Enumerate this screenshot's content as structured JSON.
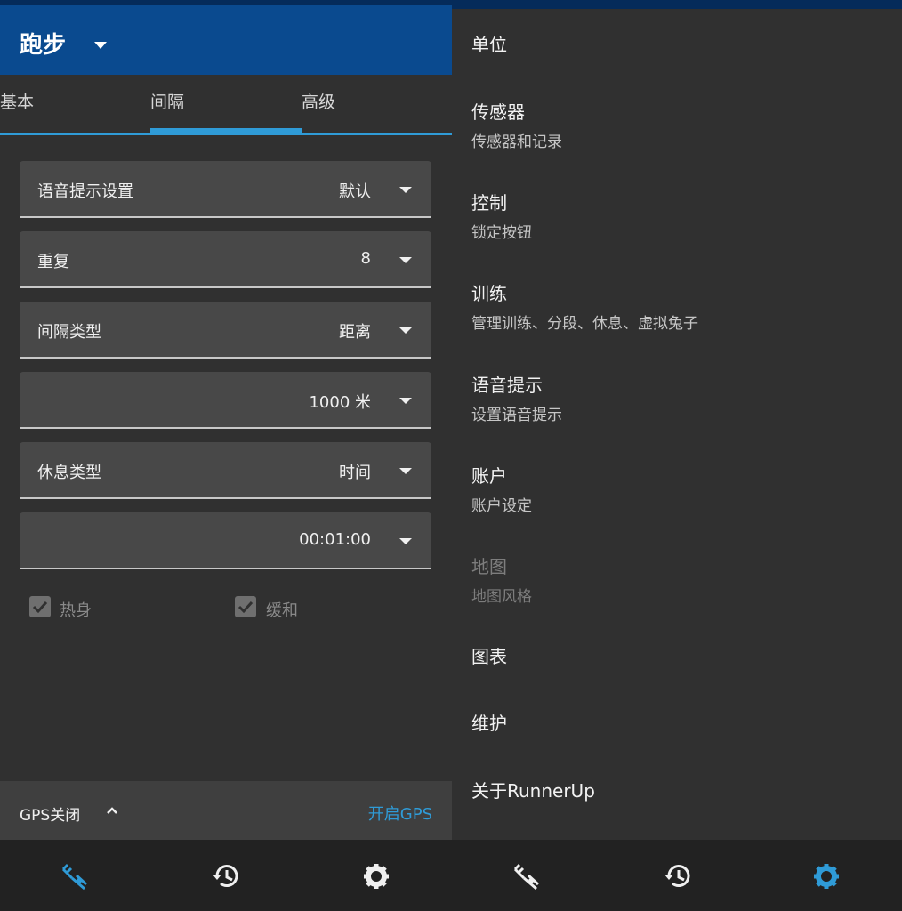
{
  "left": {
    "activity": "跑步",
    "tabs": [
      "基本",
      "间隔",
      "高级"
    ],
    "rows": [
      {
        "label": "语音提示设置",
        "value": "默认"
      },
      {
        "label": "重复",
        "value": "8"
      },
      {
        "label": "间隔类型",
        "value": "距离"
      },
      {
        "label": "",
        "value": "1000 米"
      },
      {
        "label": "休息类型",
        "value": "时间"
      },
      {
        "label": "",
        "value": "00:01:00"
      }
    ],
    "checkboxes": [
      {
        "label": "热身",
        "checked": true
      },
      {
        "label": "缓和",
        "checked": true
      }
    ],
    "gps": {
      "status": "GPS关闭",
      "enable": "开启GPS"
    }
  },
  "right": {
    "prefs": [
      {
        "title": "单位",
        "summary": ""
      },
      {
        "title": "传感器",
        "summary": "传感器和记录"
      },
      {
        "title": "控制",
        "summary": "锁定按钮"
      },
      {
        "title": "训练",
        "summary": "管理训练、分段、休息、虚拟兔子"
      },
      {
        "title": "语音提示",
        "summary": "设置语音提示"
      },
      {
        "title": "账户",
        "summary": "账户设定"
      },
      {
        "title": "地图",
        "summary": "地图风格"
      },
      {
        "title": "图表",
        "summary": ""
      },
      {
        "title": "维护",
        "summary": ""
      },
      {
        "title": "关于RunnerUp",
        "summary": ""
      }
    ]
  },
  "nav": {
    "items": [
      "start-icon",
      "history-icon",
      "settings-icon"
    ],
    "left_active": "start-icon",
    "right_active": "settings-icon"
  },
  "colors": {
    "accent": "#2f9bd7",
    "appbar": "#0a4a8f",
    "background": "#303030"
  }
}
